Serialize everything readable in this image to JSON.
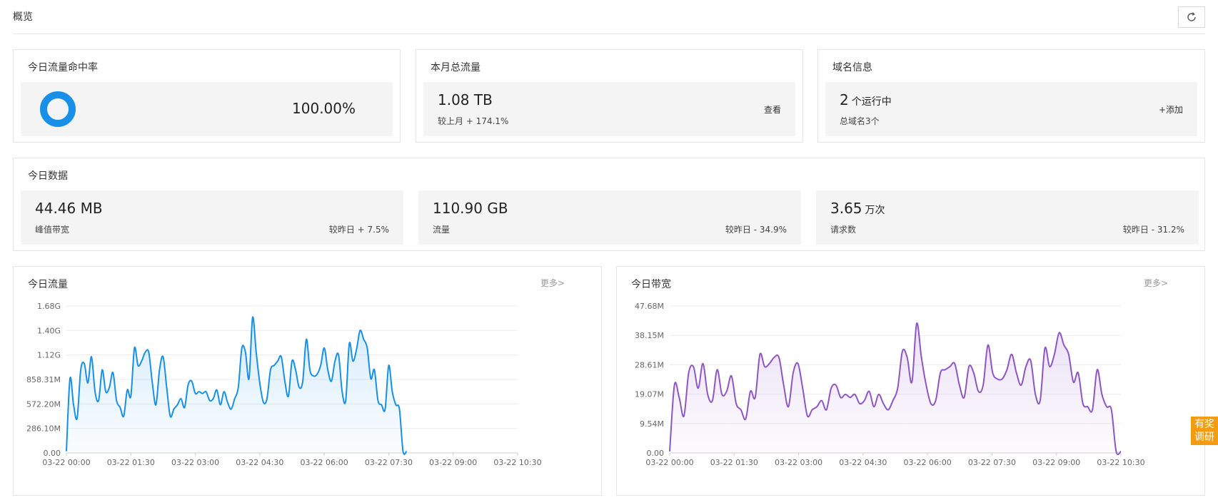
{
  "header": {
    "title": "概览"
  },
  "hit_card": {
    "title": "今日流量命中率",
    "value": "100.00%",
    "ratio": 1.0,
    "color": "#1890e8"
  },
  "monthly_card": {
    "title": "本月总流量",
    "value": "1.08 TB",
    "compare": "较上月 + 174.1%",
    "view_link": "查看"
  },
  "domain_card": {
    "title": "域名信息",
    "running_count": "2",
    "running_label": "个运行中",
    "total": "总域名3个",
    "add_link": "+添加"
  },
  "today_data": {
    "title": "今日数据",
    "stats": [
      {
        "value": "44.46 MB",
        "unit": "",
        "label": "峰值带宽",
        "compare": "较昨日 + 7.5%"
      },
      {
        "value": "110.90 GB",
        "unit": "",
        "label": "流量",
        "compare": "较昨日 - 34.9%"
      },
      {
        "value": "3.65",
        "unit": "万次",
        "label": "请求数",
        "compare": "较昨日 - 31.2%"
      }
    ]
  },
  "charts": {
    "traffic": {
      "title": "今日流量",
      "more": "更多>"
    },
    "bandwidth": {
      "title": "今日带宽",
      "more": "更多>"
    }
  },
  "survey": {
    "line1": "有奖",
    "line2": "调研"
  },
  "chart_data": [
    {
      "type": "area",
      "x_ticks": [
        "03-22 00:00",
        "03-22 01:30",
        "03-22 03:00",
        "03-22 04:30",
        "03-22 06:00",
        "03-22 07:30",
        "03-22 09:00",
        "03-22 10:30"
      ],
      "y_ticks": [
        "0.00",
        "286.10M",
        "572.20M",
        "858.31M",
        "1.12G",
        "1.40G",
        "1.68G"
      ],
      "ylim": [
        0,
        1.68
      ],
      "x_minutes_range": [
        0,
        630
      ],
      "color": "#1890e8",
      "grid": true,
      "series": [
        {
          "x_minutes": [
            0,
            5,
            10,
            15,
            20,
            25,
            30,
            35,
            40,
            45,
            50,
            55,
            60,
            65,
            70,
            75,
            80,
            85,
            90,
            95,
            100,
            105,
            110,
            115,
            120,
            125,
            130,
            135,
            140,
            145,
            150,
            155,
            160,
            165,
            170,
            175,
            180,
            185,
            190,
            195,
            200,
            205,
            210,
            215,
            220,
            225,
            230,
            235,
            240,
            245,
            250,
            255,
            260,
            265,
            270,
            275,
            280,
            285,
            290,
            295,
            300,
            305,
            310,
            315,
            320,
            325,
            330,
            335,
            340,
            345,
            350,
            355,
            360,
            365,
            370,
            375,
            380,
            385,
            390,
            395,
            400,
            405,
            410,
            415,
            420,
            425,
            430,
            435,
            440,
            445,
            450,
            455,
            460,
            465,
            470,
            475,
            480,
            485,
            490,
            495,
            500,
            505,
            510,
            515,
            520,
            525,
            530,
            535,
            540,
            545,
            550,
            555,
            560,
            565,
            570,
            575,
            580,
            585,
            590,
            595,
            600,
            605,
            610,
            615,
            620,
            625,
            630
          ],
          "values": [
            0.02,
            0.85,
            0.55,
            0.4,
            0.95,
            1.02,
            0.8,
            1.1,
            0.7,
            0.6,
            0.95,
            0.7,
            0.75,
            0.92,
            0.6,
            0.52,
            0.42,
            0.72,
            0.65,
            1.2,
            1.0,
            1.05,
            1.15,
            1.15,
            0.8,
            0.55,
            0.95,
            1.1,
            0.75,
            0.42,
            0.5,
            0.55,
            0.62,
            0.52,
            0.78,
            0.82,
            0.68,
            0.7,
            0.68,
            0.7,
            0.6,
            0.62,
            0.72,
            0.55,
            0.7,
            0.58,
            0.5,
            0.62,
            0.75,
            1.2,
            1.15,
            0.85,
            1.55,
            1.15,
            0.8,
            0.58,
            0.62,
            0.95,
            1.0,
            1.05,
            1.1,
            0.82,
            0.65,
            1.05,
            0.95,
            0.75,
            0.82,
            1.3,
            0.95,
            0.88,
            0.9,
            1.0,
            1.2,
            0.95,
            0.82,
            1.05,
            1.12,
            0.7,
            0.6,
            1.25,
            1.05,
            1.18,
            1.4,
            1.3,
            1.2,
            0.85,
            0.95,
            0.6,
            0.55,
            0.5,
            1.0,
            0.7,
            0.55,
            0.5,
            0.02,
            0.02
          ],
          "_note": ""
        }
      ]
    },
    {
      "type": "area",
      "x_ticks": [
        "03-22 00:00",
        "03-22 01:30",
        "03-22 03:00",
        "03-22 04:30",
        "03-22 06:00",
        "03-22 07:30",
        "03-22 09:00",
        "03-22 10:30"
      ],
      "y_ticks": [
        "0.00",
        "9.54M",
        "19.07M",
        "28.61M",
        "38.15M",
        "47.68M"
      ],
      "ylim": [
        0,
        47.68
      ],
      "x_minutes_range": [
        0,
        630
      ],
      "color": "#8e55c9",
      "grid": true,
      "series": [
        {
          "values": [
            0.5,
            22,
            18,
            12,
            26,
            28,
            21,
            29,
            19,
            17,
            27,
            19,
            20,
            25,
            16,
            14,
            11,
            20,
            18,
            32,
            28,
            29,
            31,
            31,
            22,
            15,
            26,
            29,
            21,
            12,
            14,
            15,
            17,
            14,
            21,
            22,
            18,
            19,
            18,
            19,
            16,
            17,
            20,
            15,
            19,
            16,
            14,
            17,
            21,
            33,
            31,
            23,
            42,
            31,
            22,
            16,
            17,
            26,
            27,
            28,
            29,
            22,
            18,
            28,
            26,
            20,
            22,
            35,
            26,
            24,
            24,
            27,
            32,
            26,
            22,
            28,
            30,
            19,
            17,
            34,
            28,
            32,
            39,
            35,
            32,
            23,
            26,
            16,
            15,
            14,
            27,
            19,
            15,
            14,
            0.5,
            0.5
          ]
        }
      ]
    }
  ]
}
